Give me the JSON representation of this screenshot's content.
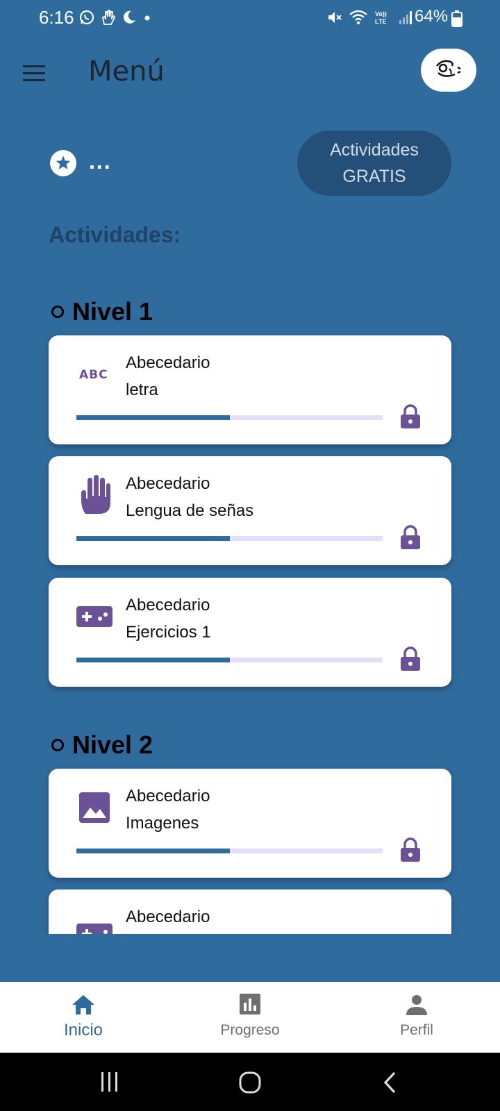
{
  "status_bar": {
    "time": "6:16",
    "battery": "64%",
    "left_icons": [
      "whatsapp-icon",
      "hand-icon",
      "moon-icon",
      "dot-icon"
    ],
    "right_icons": [
      "mute-icon",
      "wifi-icon",
      "volte-icon",
      "signal-icon",
      "battery-icon"
    ]
  },
  "app_bar": {
    "title": "Menú",
    "menu_icon": "hamburger-icon",
    "avatar_icon": "avatar-icon"
  },
  "streak": {
    "icon": "star-icon",
    "text": "..."
  },
  "free_button": {
    "line1": "Actividades",
    "line2": "GRATIS"
  },
  "activities_heading": "Actividades:",
  "levels": [
    {
      "title": "Nivel 1",
      "activities": [
        {
          "line1": "Abecedario",
          "line2": "letra",
          "icon": "abc-icon",
          "progress": 0.5,
          "locked": true
        },
        {
          "line1": "Abecedario",
          "line2": "Lengua de señas",
          "icon": "hand-icon",
          "progress": 0.5,
          "locked": true
        },
        {
          "line1": "Abecedario",
          "line2": "Ejercicios 1",
          "icon": "gamepad-icon",
          "progress": 0.5,
          "locked": true
        }
      ]
    },
    {
      "title": "Nivel 2",
      "activities": [
        {
          "line1": "Abecedario",
          "line2": "Imagenes",
          "icon": "image-icon",
          "progress": 0.5,
          "locked": true
        },
        {
          "line1": "Abecedario",
          "line2": "",
          "icon": "gamepad-icon",
          "progress": 0.5,
          "locked": true
        }
      ]
    }
  ],
  "bottom_nav": {
    "items": [
      {
        "label": "Inicio",
        "icon": "home-icon",
        "active": true
      },
      {
        "label": "Progreso",
        "icon": "bar-chart-icon",
        "active": false
      },
      {
        "label": "Perfil",
        "icon": "person-icon",
        "active": false
      }
    ]
  },
  "system_nav": [
    "recents-icon",
    "home-circle-icon",
    "back-icon"
  ],
  "colors": {
    "background": "#2f6b9d",
    "icon_purple": "#6b5196",
    "progress_fill": "#2f6b9d",
    "progress_track": "#e6def8",
    "free_button_bg": "#234f78",
    "nav_active": "#2f6b9d"
  }
}
